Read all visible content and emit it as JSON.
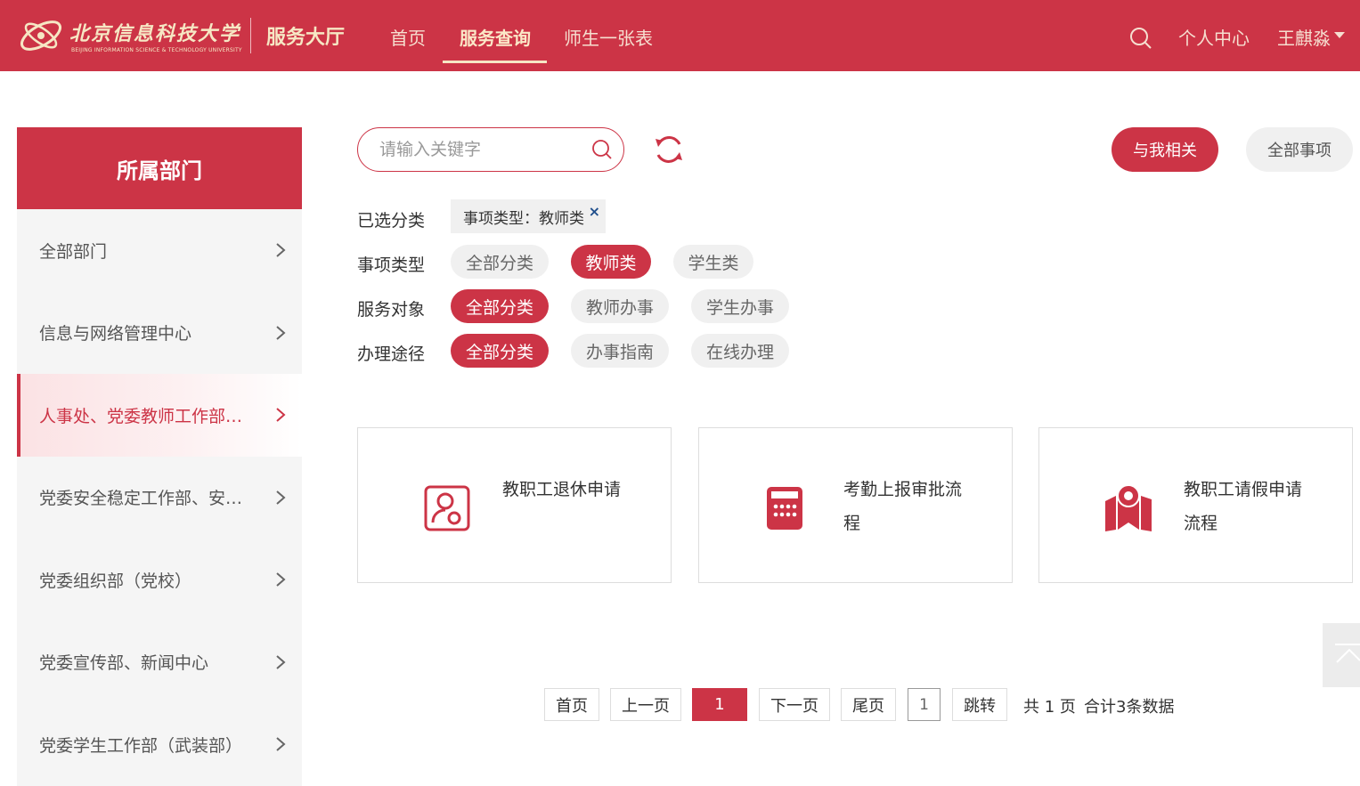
{
  "header": {
    "logo_cn": "北京信息科技大学",
    "logo_en": "BEIJING INFORMATION SCIENCE & TECHNOLOGY UNIVERSITY",
    "site_title": "服务大厅",
    "nav": [
      {
        "label": "首页"
      },
      {
        "label": "服务查询"
      },
      {
        "label": "师生一张表"
      }
    ],
    "personal_center": "个人中心",
    "user_name": "王麒淼"
  },
  "sidebar": {
    "title": "所属部门",
    "items": [
      {
        "label": "全部部门"
      },
      {
        "label": "信息与网络管理中心"
      },
      {
        "label": "人事处、党委教师工作部、党委教师工作部"
      },
      {
        "label": "党委安全稳定工作部、安全保卫处"
      },
      {
        "label": "党委组织部（党校）"
      },
      {
        "label": "党委宣传部、新闻中心"
      },
      {
        "label": "党委学生工作部（武装部）"
      }
    ]
  },
  "search": {
    "placeholder": "请输入关键字",
    "btn_mine": "与我相关",
    "btn_all": "全部事项"
  },
  "filters": {
    "selected_label": "已选分类",
    "selected_tag": "事项类型：教师类",
    "selected_tag_remove": "×",
    "rows": [
      {
        "label": "事项类型",
        "chips": [
          "全部分类",
          "教师类",
          "学生类"
        ],
        "active": "教师类"
      },
      {
        "label": "服务对象",
        "chips": [
          "全部分类",
          "教师办事",
          "学生办事"
        ],
        "active": "全部分类"
      },
      {
        "label": "办理途径",
        "chips": [
          "全部分类",
          "办事指南",
          "在线办理"
        ],
        "active": "全部分类"
      }
    ]
  },
  "cards": [
    {
      "title": "教职工退休申请",
      "icon": "person-badge-icon"
    },
    {
      "title": "考勤上报审批流程",
      "icon": "calculator-icon"
    },
    {
      "title": "教职工请假申请流程",
      "icon": "map-pin-icon"
    }
  ],
  "pagination": {
    "first": "首页",
    "prev": "上一页",
    "current": "1",
    "next": "下一页",
    "last": "尾页",
    "jump_value": "1",
    "jump": "跳转",
    "total_pages": "共 1 页",
    "total_records": "合计3条数据"
  },
  "colors": {
    "brand": "#cc3446",
    "header_text": "#f6e7c4"
  }
}
